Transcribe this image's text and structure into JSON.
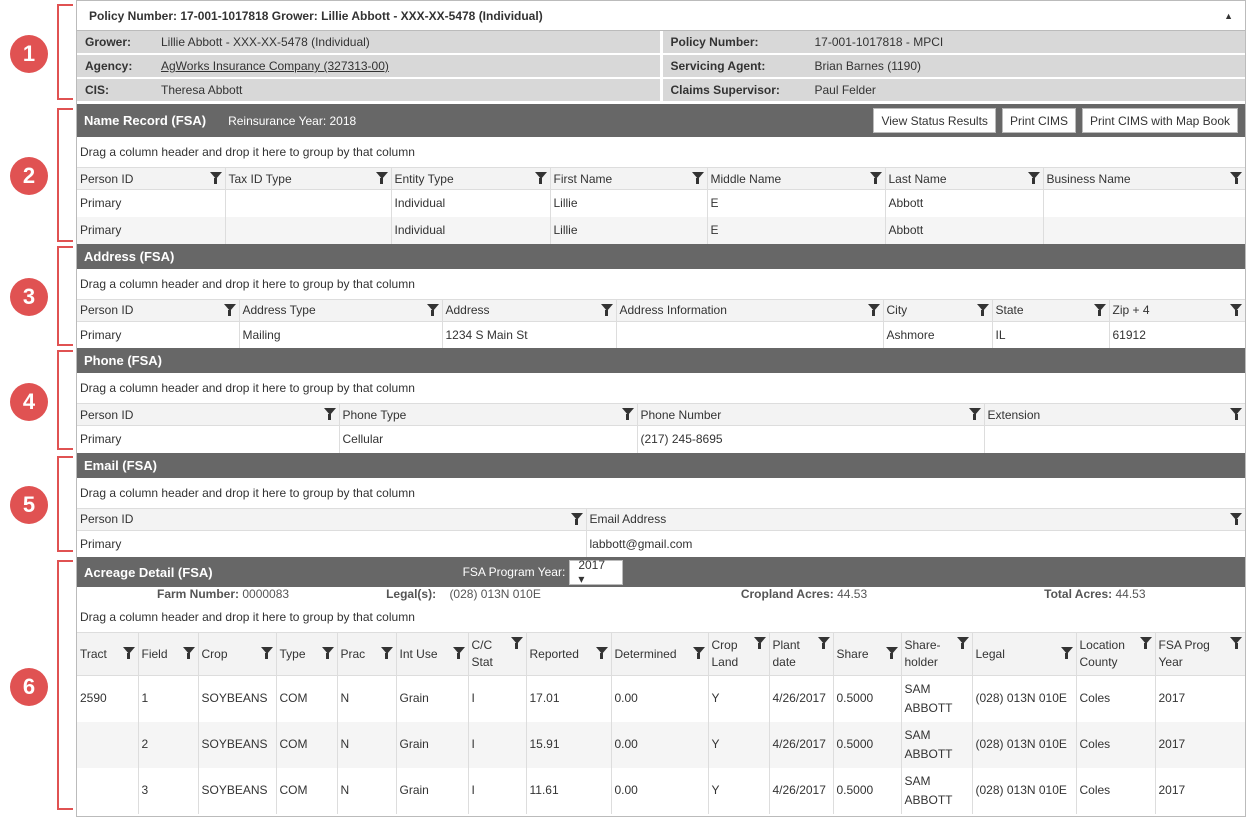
{
  "callouts": [
    "1",
    "2",
    "3",
    "4",
    "5",
    "6"
  ],
  "policy": {
    "header": "Policy Number: 17-001-1017818 Grower: Lillie Abbott - XXX-XX-5478 (Individual)",
    "collapse_icon": "triangle-up-icon",
    "left": [
      {
        "label": "Grower:",
        "value": "Lillie Abbott - XXX-XX-5478 (Individual)"
      },
      {
        "label": "Agency:",
        "value": "AgWorks Insurance Company (327313-00)"
      },
      {
        "label": "CIS:",
        "value": "Theresa Abbott"
      }
    ],
    "right": [
      {
        "label": "Policy Number:",
        "value": "17-001-1017818 - MPCI"
      },
      {
        "label": "Servicing Agent:",
        "value": "Brian Barnes (1190)"
      },
      {
        "label": "Claims Supervisor:",
        "value": "Paul Felder"
      }
    ]
  },
  "group_hint": "Drag a column header and drop it here to group by that column",
  "name_record": {
    "title": "Name Record (FSA)",
    "subtitle": "Reinsurance Year: 2018",
    "buttons": [
      "View Status Results",
      "Print CIMS",
      "Print CIMS with Map Book"
    ],
    "columns": [
      "Person ID",
      "Tax ID Type",
      "Entity Type",
      "First Name",
      "Middle Name",
      "Last Name",
      "Business Name"
    ],
    "rows": [
      [
        "Primary",
        "",
        "Individual",
        "Lillie",
        "E",
        "Abbott",
        ""
      ],
      [
        "Primary",
        "",
        "Individual",
        "Lillie",
        "E",
        "Abbott",
        ""
      ]
    ]
  },
  "address": {
    "title": "Address (FSA)",
    "columns": [
      "Person ID",
      "Address Type",
      "Address",
      "Address Information",
      "City",
      "State",
      "Zip + 4"
    ],
    "rows": [
      [
        "Primary",
        "Mailing",
        "1234 S Main St",
        "",
        "Ashmore",
        "IL",
        "61912"
      ]
    ]
  },
  "phone": {
    "title": "Phone (FSA)",
    "columns": [
      "Person ID",
      "Phone Type",
      "Phone Number",
      "Extension"
    ],
    "rows": [
      [
        "Primary",
        "Cellular",
        "(217) 245-8695",
        ""
      ]
    ]
  },
  "email": {
    "title": "Email (FSA)",
    "columns": [
      "Person ID",
      "Email Address"
    ],
    "rows": [
      [
        "Primary",
        "labbott@gmail.com"
      ]
    ]
  },
  "acreage": {
    "title": "Acreage Detail (FSA)",
    "year_label": "FSA Program Year:",
    "year_value": "2017 ▾",
    "farm": [
      {
        "label": "Farm Number:",
        "value": "0000083"
      },
      {
        "label": "Legal(s):",
        "value": "(028) 013N 010E"
      },
      {
        "label": "Cropland Acres:",
        "value": "44.53"
      },
      {
        "label": "Total Acres:",
        "value": "44.53"
      }
    ],
    "columns": [
      "Tract",
      "Field",
      "Crop",
      "Type",
      "Prac",
      "Int Use",
      "C/C Stat",
      "Reported",
      "Determined",
      "Crop Land",
      "Plant date",
      "Share",
      "Share-holder",
      "Legal",
      "Location County",
      "FSA Prog Year"
    ],
    "rows": [
      [
        "2590",
        "1",
        "SOYBEANS",
        "COM",
        "N",
        "Grain",
        "I",
        "17.01",
        "0.00",
        "Y",
        "4/26/2017",
        "0.5000",
        "SAM ABBOTT",
        "(028) 013N 010E",
        "Coles",
        "2017"
      ],
      [
        "",
        "2",
        "SOYBEANS",
        "COM",
        "N",
        "Grain",
        "I",
        "15.91",
        "0.00",
        "Y",
        "4/26/2017",
        "0.5000",
        "SAM ABBOTT",
        "(028) 013N 010E",
        "Coles",
        "2017"
      ],
      [
        "",
        "3",
        "SOYBEANS",
        "COM",
        "N",
        "Grain",
        "I",
        "11.61",
        "0.00",
        "Y",
        "4/26/2017",
        "0.5000",
        "SAM ABBOTT",
        "(028) 013N 010E",
        "Coles",
        "2017"
      ]
    ]
  }
}
